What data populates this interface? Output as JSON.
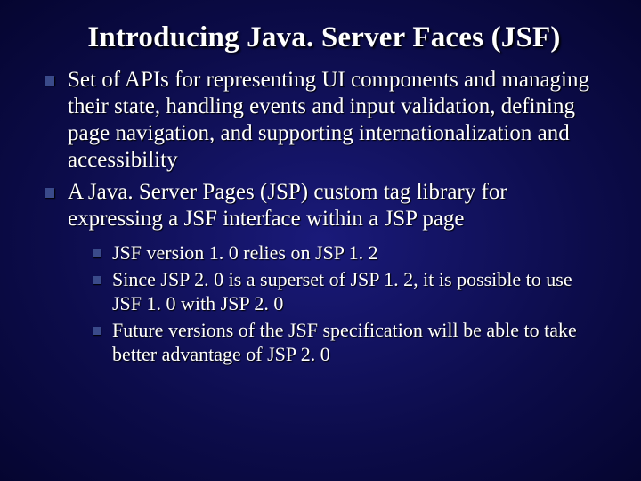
{
  "title": "Introducing Java. Server Faces (JSF)",
  "bullets": [
    {
      "text": "Set of APIs for representing UI components and managing their state, handling events and input validation, defining page navigation, and supporting internationalization and accessibility"
    },
    {
      "text": "A Java. Server Pages (JSP) custom tag library for expressing a JSF interface within a JSP page",
      "children": [
        {
          "text": "JSF version 1. 0 relies on JSP 1. 2"
        },
        {
          "text": "Since JSP 2. 0 is a superset of JSP 1. 2, it is possible to use JSF 1. 0 with JSP 2. 0"
        },
        {
          "text": "Future versions of the JSF specification will be able to take better advantage of JSP 2. 0"
        }
      ]
    }
  ]
}
